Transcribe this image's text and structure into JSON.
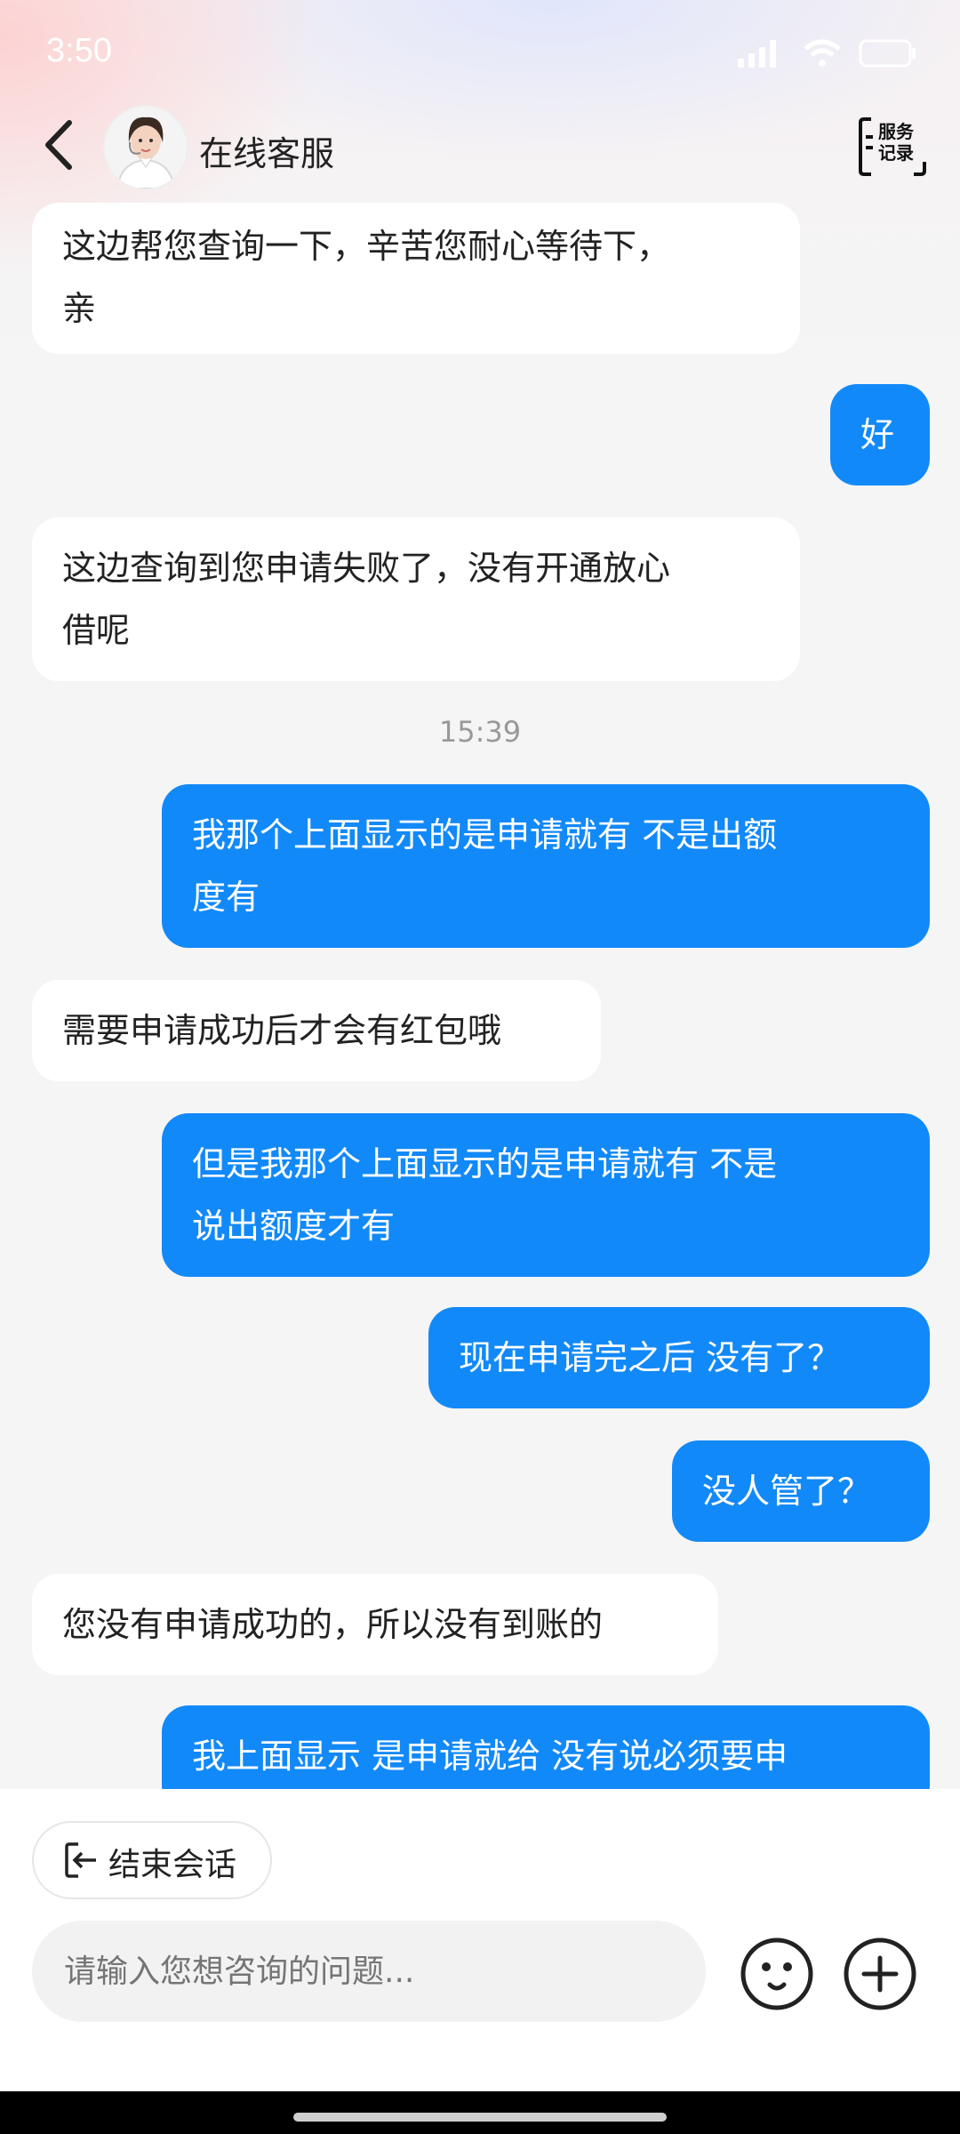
{
  "status_bar": {
    "time": "3:50"
  },
  "header": {
    "title": "在线客服",
    "service_record_label": "服务\n记录"
  },
  "messages": [
    {
      "role": "agent",
      "lines": [
        "这边帮您查询一下，辛苦您耐心等待下，",
        "亲"
      ]
    },
    {
      "role": "user",
      "lines": [
        "好"
      ]
    },
    {
      "role": "agent",
      "lines": [
        "这边查询到您申请失败了，没有开通放心",
        "借呢"
      ]
    },
    {
      "role": "user",
      "lines": [
        "我那个上面显示的是申请就有 不是出额",
        "度有"
      ]
    },
    {
      "role": "agent",
      "lines": [
        "需要申请成功后才会有红包哦"
      ]
    },
    {
      "role": "user",
      "lines": [
        "但是我那个上面显示的是申请就有 不是",
        "说出额度才有"
      ]
    },
    {
      "role": "user",
      "lines": [
        "现在申请完之后 没有了？"
      ]
    },
    {
      "role": "user",
      "lines": [
        "没人管了？"
      ]
    },
    {
      "role": "agent",
      "lines": [
        "您没有申请成功的，所以没有到账的"
      ]
    },
    {
      "role": "user",
      "lines": [
        "我上面显示 是申请就给 没有说必须要申"
      ]
    }
  ],
  "timestamp": "15:39",
  "bottom": {
    "end_chat_label": "结束会话",
    "input_placeholder": "请输入您想咨询的问题..."
  },
  "colors": {
    "user_bubble": "#1289f8",
    "agent_bubble": "#ffffff",
    "background": "#f5f5f5"
  }
}
